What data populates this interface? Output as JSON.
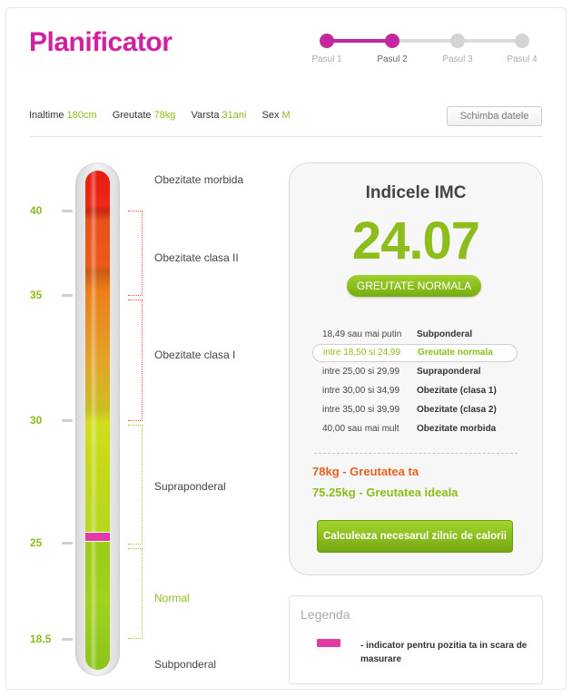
{
  "app": {
    "title": "Planificator"
  },
  "steps": [
    {
      "label": "Pasul 1",
      "state": "done"
    },
    {
      "label": "Pasul 2",
      "state": "current"
    },
    {
      "label": "Pasul 3",
      "state": "todo"
    },
    {
      "label": "Pasul 4",
      "state": "todo"
    }
  ],
  "profile": {
    "height_label": "Inaltime",
    "height_value": "180cm",
    "weight_label": "Greutate",
    "weight_value": "78kg",
    "age_label": "Varsta",
    "age_value": "31ani",
    "sex_label": "Sex",
    "sex_value": "M",
    "change_button": "Schimba datele"
  },
  "scale": {
    "ticks": [
      "40",
      "35",
      "30",
      "25",
      "18.5"
    ],
    "zones": [
      "Obezitate morbida",
      "Obezitate clasa II",
      "Obezitate clasa I",
      "Supraponderal",
      "Normal",
      "Subponderal"
    ],
    "indicator_value": 24.07
  },
  "result": {
    "title": "Indicele IMC",
    "value": "24.07",
    "status": "GREUTATE NORMALA",
    "ranges": [
      {
        "range": "18,49 sau mai putin",
        "category": "Subponderal"
      },
      {
        "range": "intre 18,50 si 24,99",
        "category": "Greutate normala"
      },
      {
        "range": "intre 25,00 si 29,99",
        "category": "Supraponderal"
      },
      {
        "range": "intre 30,00 si 34,99",
        "category": "Obezitate (clasa 1)"
      },
      {
        "range": "intre 35,00 si 39,99",
        "category": "Obezitate (clasa 2)"
      },
      {
        "range": "40,00 sau mai mult",
        "category": "Obezitate morbida"
      }
    ],
    "current_weight": "78kg - Greutatea ta",
    "ideal_weight": "75.25kg - Greutatea ideala",
    "calc_button": "Calculeaza necesarul zilnic de calorii"
  },
  "legend": {
    "title": "Legenda",
    "text": "- indicator pentru pozitia ta in scara de masurare"
  },
  "colors": {
    "accent": "#d0219f",
    "green": "#8cbd1a",
    "orange": "#e9611e"
  }
}
